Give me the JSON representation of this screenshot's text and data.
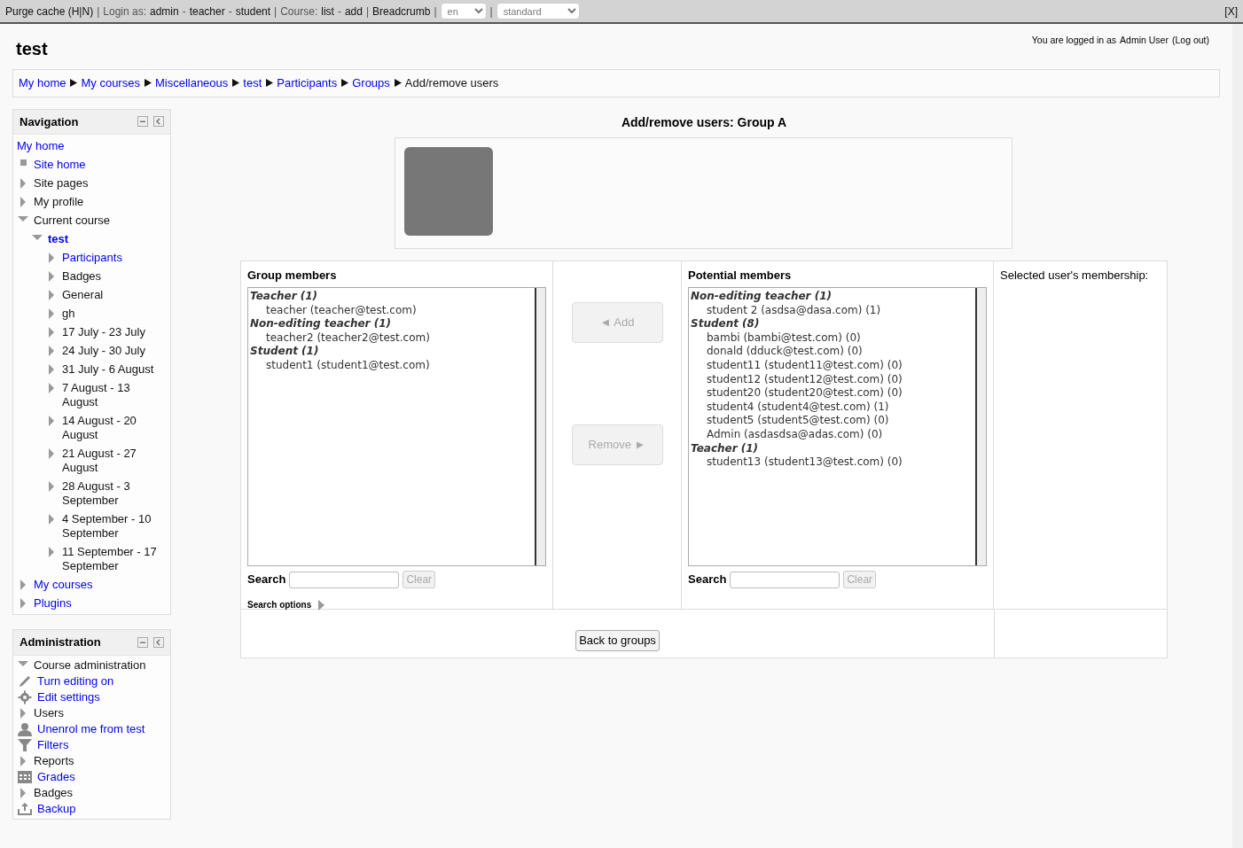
{
  "devbar": {
    "segments": [
      {
        "kind": "link",
        "text": "Purge cache (H|N)"
      },
      {
        "kind": "sep",
        "text": "|"
      },
      {
        "kind": "label",
        "text": "Login as:"
      },
      {
        "kind": "link",
        "text": "admin"
      },
      {
        "kind": "label",
        "text": "-"
      },
      {
        "kind": "link",
        "text": "teacher"
      },
      {
        "kind": "label",
        "text": "-"
      },
      {
        "kind": "link",
        "text": "student"
      },
      {
        "kind": "sep",
        "text": "|"
      },
      {
        "kind": "label",
        "text": "Course:"
      },
      {
        "kind": "link",
        "text": "list"
      },
      {
        "kind": "label",
        "text": "-"
      },
      {
        "kind": "link",
        "text": "add"
      },
      {
        "kind": "sep",
        "text": "|"
      },
      {
        "kind": "link",
        "text": "Breadcrumb"
      },
      {
        "kind": "sep",
        "text": "|"
      },
      {
        "kind": "select",
        "text": "en"
      },
      {
        "kind": "sep",
        "text": "|"
      },
      {
        "kind": "select",
        "text": "standard"
      }
    ],
    "close": "[X]"
  },
  "header": {
    "title": "test",
    "login_text": "You are logged in as",
    "user": "Admin User",
    "logout": "(Log out)"
  },
  "breadcrumb": [
    {
      "label": "My home",
      "link": true
    },
    {
      "label": "My courses",
      "link": true
    },
    {
      "label": "Miscellaneous",
      "link": true
    },
    {
      "label": "test",
      "link": true
    },
    {
      "label": "Participants",
      "link": true
    },
    {
      "label": "Groups",
      "link": true
    },
    {
      "label": "Add/remove users",
      "link": false
    }
  ],
  "navigation": {
    "title": "Navigation",
    "items": [
      {
        "label": "My home",
        "kind": "root",
        "link": true
      },
      {
        "label": "Site home",
        "kind": "leaf",
        "link": true
      },
      {
        "label": "Site pages",
        "kind": "branch",
        "link": false,
        "expanded": false
      },
      {
        "label": "My profile",
        "kind": "branch",
        "link": false,
        "expanded": false
      },
      {
        "label": "Current course",
        "kind": "branch",
        "link": false,
        "expanded": true,
        "children": [
          {
            "label": "test",
            "kind": "course",
            "link": true,
            "expanded": true,
            "children": [
              {
                "label": "Participants",
                "kind": "branch",
                "link": true,
                "expanded": false
              },
              {
                "label": "Badges",
                "kind": "branch",
                "link": false,
                "expanded": false
              },
              {
                "label": "General",
                "kind": "branch",
                "link": false,
                "expanded": false
              },
              {
                "label": "gh",
                "kind": "branch",
                "link": false,
                "expanded": false
              },
              {
                "label": "17 July - 23 July",
                "kind": "branch",
                "link": false,
                "expanded": false
              },
              {
                "label": "24 July - 30 July",
                "kind": "branch",
                "link": false,
                "expanded": false
              },
              {
                "label": "31 July - 6 August",
                "kind": "branch",
                "link": false,
                "expanded": false
              },
              {
                "label": "7 August - 13 August",
                "kind": "branch",
                "link": false,
                "expanded": false
              },
              {
                "label": "14 August - 20 August",
                "kind": "branch",
                "link": false,
                "expanded": false
              },
              {
                "label": "21 August - 27 August",
                "kind": "branch",
                "link": false,
                "expanded": false
              },
              {
                "label": "28 August - 3 September",
                "kind": "branch",
                "link": false,
                "expanded": false
              },
              {
                "label": "4 September - 10 September",
                "kind": "branch",
                "link": false,
                "expanded": false
              },
              {
                "label": "11 September - 17 September",
                "kind": "branch",
                "link": false,
                "expanded": false
              }
            ]
          }
        ]
      },
      {
        "label": "My courses",
        "kind": "branch",
        "link": true,
        "expanded": false
      },
      {
        "label": "Plugins",
        "kind": "branch",
        "link": true,
        "expanded": false
      }
    ]
  },
  "administration": {
    "title": "Administration",
    "items": [
      {
        "label": "Course administration",
        "kind": "branch",
        "link": false,
        "expanded": true,
        "children": [
          {
            "label": "Turn editing on",
            "kind": "edit",
            "link": true
          },
          {
            "label": "Edit settings",
            "kind": "settings",
            "link": true
          },
          {
            "label": "Users",
            "kind": "branch",
            "link": false,
            "expanded": false
          },
          {
            "label": "Unenrol me from test",
            "kind": "user",
            "link": true
          },
          {
            "label": "Filters",
            "kind": "filter",
            "link": true
          },
          {
            "label": "Reports",
            "kind": "branch",
            "link": false,
            "expanded": false
          },
          {
            "label": "Grades",
            "kind": "grades",
            "link": true
          },
          {
            "label": "Badges",
            "kind": "branch",
            "link": false,
            "expanded": false
          },
          {
            "label": "Backup",
            "kind": "backup",
            "link": true
          }
        ]
      }
    ]
  },
  "main": {
    "heading": "Add/remove users: Group A",
    "group_members": {
      "title": "Group members",
      "groups": [
        {
          "label": "Teacher (1)",
          "users": [
            "teacher (teacher@test.com)"
          ]
        },
        {
          "label": "Non-editing teacher (1)",
          "users": [
            "teacher2 (teacher2@test.com)"
          ]
        },
        {
          "label": "Student (1)",
          "users": [
            "student1 (student1@test.com)"
          ]
        }
      ],
      "search_label": "Search",
      "clear": "Clear",
      "search_options": "Search options"
    },
    "add_button": "◄ Add",
    "remove_button": "Remove ►",
    "potential_members": {
      "title": "Potential members",
      "groups": [
        {
          "label": "Non-editing teacher (1)",
          "users": [
            "student 2 (asdsa@dasa.com) (1)"
          ]
        },
        {
          "label": "Student (8)",
          "users": [
            "bambi (bambi@test.com) (0)",
            "donald (dduck@test.com) (0)",
            "student11 (student11@test.com) (0)",
            "student12 (student12@test.com) (0)",
            "student20 (student20@test.com) (0)",
            "student4 (student4@test.com) (1)",
            "student5 (student5@test.com) (0)",
            "Admin (asdasdsa@adas.com) (0)"
          ]
        },
        {
          "label": "Teacher (1)",
          "users": [
            "student13 (student13@test.com) (0)"
          ]
        }
      ],
      "search_label": "Search",
      "clear": "Clear"
    },
    "membership_label": "Selected user's membership:",
    "back_button": "Back to groups"
  }
}
